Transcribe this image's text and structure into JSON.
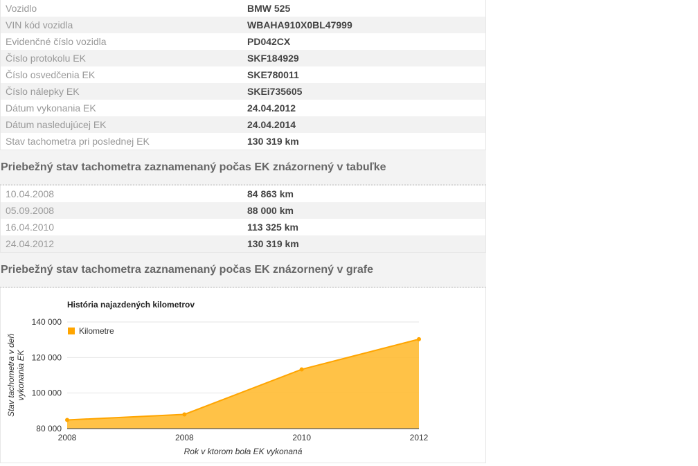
{
  "vehicle_info": [
    {
      "label": "Vozidlo",
      "value": "BMW 525"
    },
    {
      "label": "VIN kód vozidla",
      "value": "WBAHA910X0BL47999"
    },
    {
      "label": "Evidenčné číslo vozidla",
      "value": "PD042CX"
    },
    {
      "label": "Číslo protokolu EK",
      "value": "SKF184929"
    },
    {
      "label": "Číslo osvedčenia EK",
      "value": "SKE780011"
    },
    {
      "label": "Číslo nálepky EK",
      "value": "SKEi735605"
    },
    {
      "label": "Dátum vykonania EK",
      "value": "24.04.2012"
    },
    {
      "label": "Dátum nasledujúcej EK",
      "value": "24.04.2014"
    },
    {
      "label": "Stav tachometra pri poslednej EK",
      "value": "130 319 km"
    }
  ],
  "table_section_title": "Priebežný stav tachometra zaznamenaný počas EK znázornený v tabuľke",
  "odometer_table": [
    {
      "date": "10.04.2008",
      "km": "84 863 km"
    },
    {
      "date": "05.09.2008",
      "km": "88 000 km"
    },
    {
      "date": "16.04.2010",
      "km": "113 325 km"
    },
    {
      "date": "24.04.2012",
      "km": "130 319 km"
    }
  ],
  "chart_section_title": "Priebežný stav tachometra zaznamenaný počas EK znázornený v grafe",
  "colors": {
    "series": "#ffa500",
    "area": "#ffbb33"
  },
  "chart_data": {
    "type": "area",
    "title": "História najazdených kilometrov",
    "xlabel": "Rok v ktorom bola EK vykonaná",
    "ylabel": "Stav tachometra v deň vykonania EK",
    "ylabel_lines": [
      "Stav tachometra v deň",
      "vykonania EK"
    ],
    "categories": [
      "2008",
      "2008",
      "2010",
      "2012"
    ],
    "series": [
      {
        "name": "Kilometre",
        "values": [
          84863,
          88000,
          113325,
          130319
        ]
      }
    ],
    "ylim": [
      80000,
      140000
    ],
    "yticks": [
      80000,
      100000,
      120000,
      140000
    ],
    "ytick_labels": [
      "80 000",
      "100 000",
      "120 000",
      "140 000"
    ],
    "grid": true,
    "legend": "top-left"
  }
}
